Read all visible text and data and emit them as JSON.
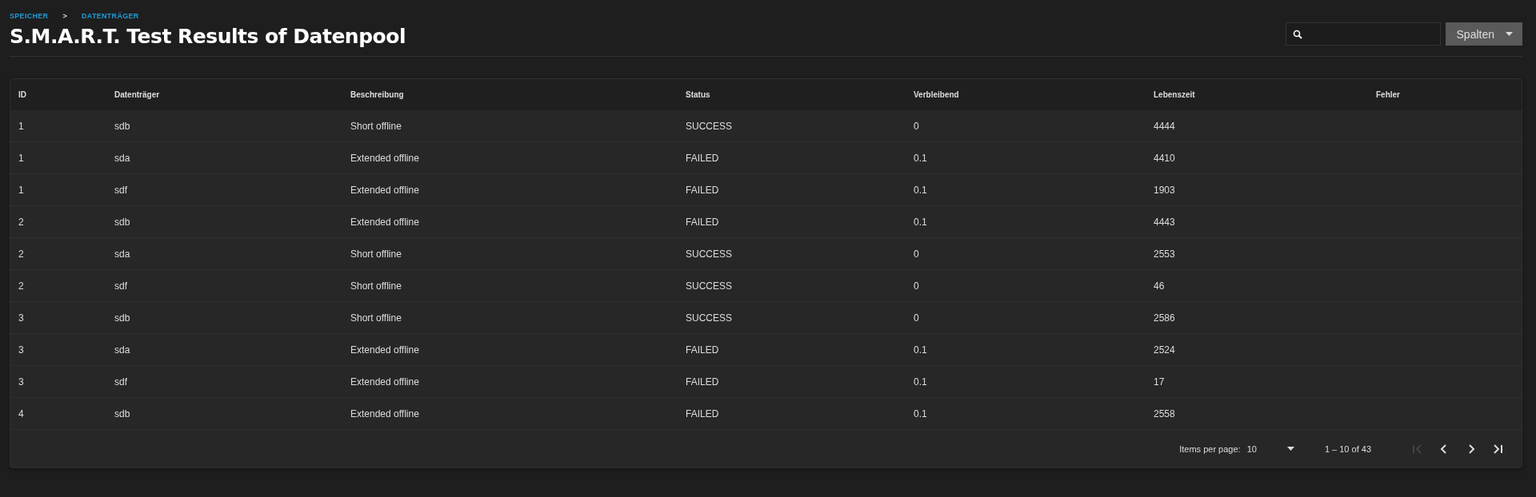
{
  "breadcrumb": [
    "SPEICHER",
    "DATENTRÄGER"
  ],
  "breadcrumb_separator": ">",
  "title": "S.M.A.R.T. Test Results of Datenpool",
  "columns_button": "Spalten",
  "table": {
    "columns": [
      "ID",
      "Datenträger",
      "Beschreibung",
      "Status",
      "Verbleibend",
      "Lebenszeit",
      "Fehler"
    ],
    "rows": [
      [
        "1",
        "sdb",
        "Short offline",
        "SUCCESS",
        "0",
        "4444"
      ],
      [
        "1",
        "sda",
        "Extended offline",
        "FAILED",
        "0.1",
        "4410"
      ],
      [
        "1",
        "sdf",
        "Extended offline",
        "FAILED",
        "0.1",
        "1903"
      ],
      [
        "2",
        "sdb",
        "Extended offline",
        "FAILED",
        "0.1",
        "4443"
      ],
      [
        "2",
        "sda",
        "Short offline",
        "SUCCESS",
        "0",
        "2553"
      ],
      [
        "2",
        "sdf",
        "Short offline",
        "SUCCESS",
        "0",
        "46"
      ],
      [
        "3",
        "sdb",
        "Short offline",
        "SUCCESS",
        "0",
        "2586"
      ],
      [
        "3",
        "sda",
        "Extended offline",
        "FAILED",
        "0.1",
        "2524"
      ],
      [
        "3",
        "sdf",
        "Extended offline",
        "FAILED",
        "0.1",
        "17"
      ],
      [
        "4",
        "sdb",
        "Extended offline",
        "FAILED",
        "0.1",
        "2558"
      ]
    ]
  },
  "paginator": {
    "items_per_page_label": "Items per page:",
    "page_size": "10",
    "range": "1 – 10 of 43",
    "buttons": [
      {
        "kind": "first",
        "disabled": true
      },
      {
        "kind": "prev",
        "disabled": false
      },
      {
        "kind": "next",
        "disabled": false
      },
      {
        "kind": "last",
        "disabled": false
      }
    ]
  }
}
